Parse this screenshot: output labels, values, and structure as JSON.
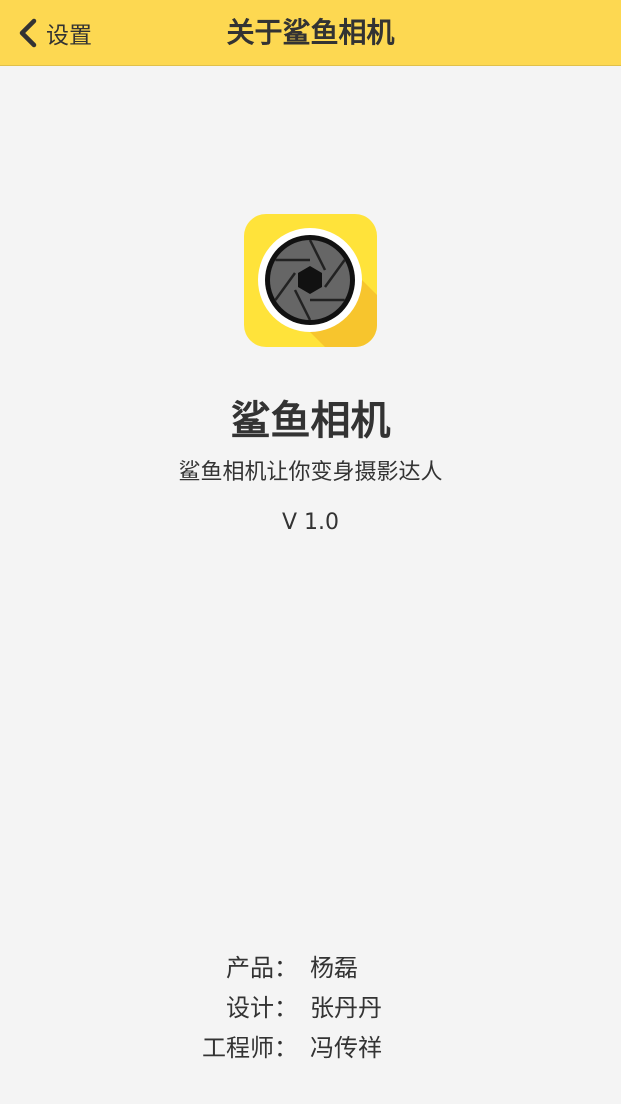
{
  "nav": {
    "back_label": "设置",
    "title": "关于鲨鱼相机"
  },
  "app": {
    "icon": "camera-aperture-icon",
    "name": "鲨鱼相机",
    "slogan": "鲨鱼相机让你变身摄影达人",
    "version": "V 1.0"
  },
  "credits": [
    {
      "role": "产品：",
      "name": "杨磊"
    },
    {
      "role": "设计：",
      "name": "张丹丹"
    },
    {
      "role": "工程师：",
      "name": "冯传祥"
    }
  ],
  "colors": {
    "nav_background": "#fdd851",
    "page_background": "#f4f4f4",
    "icon_background": "#ffe33a",
    "text": "#333333"
  }
}
